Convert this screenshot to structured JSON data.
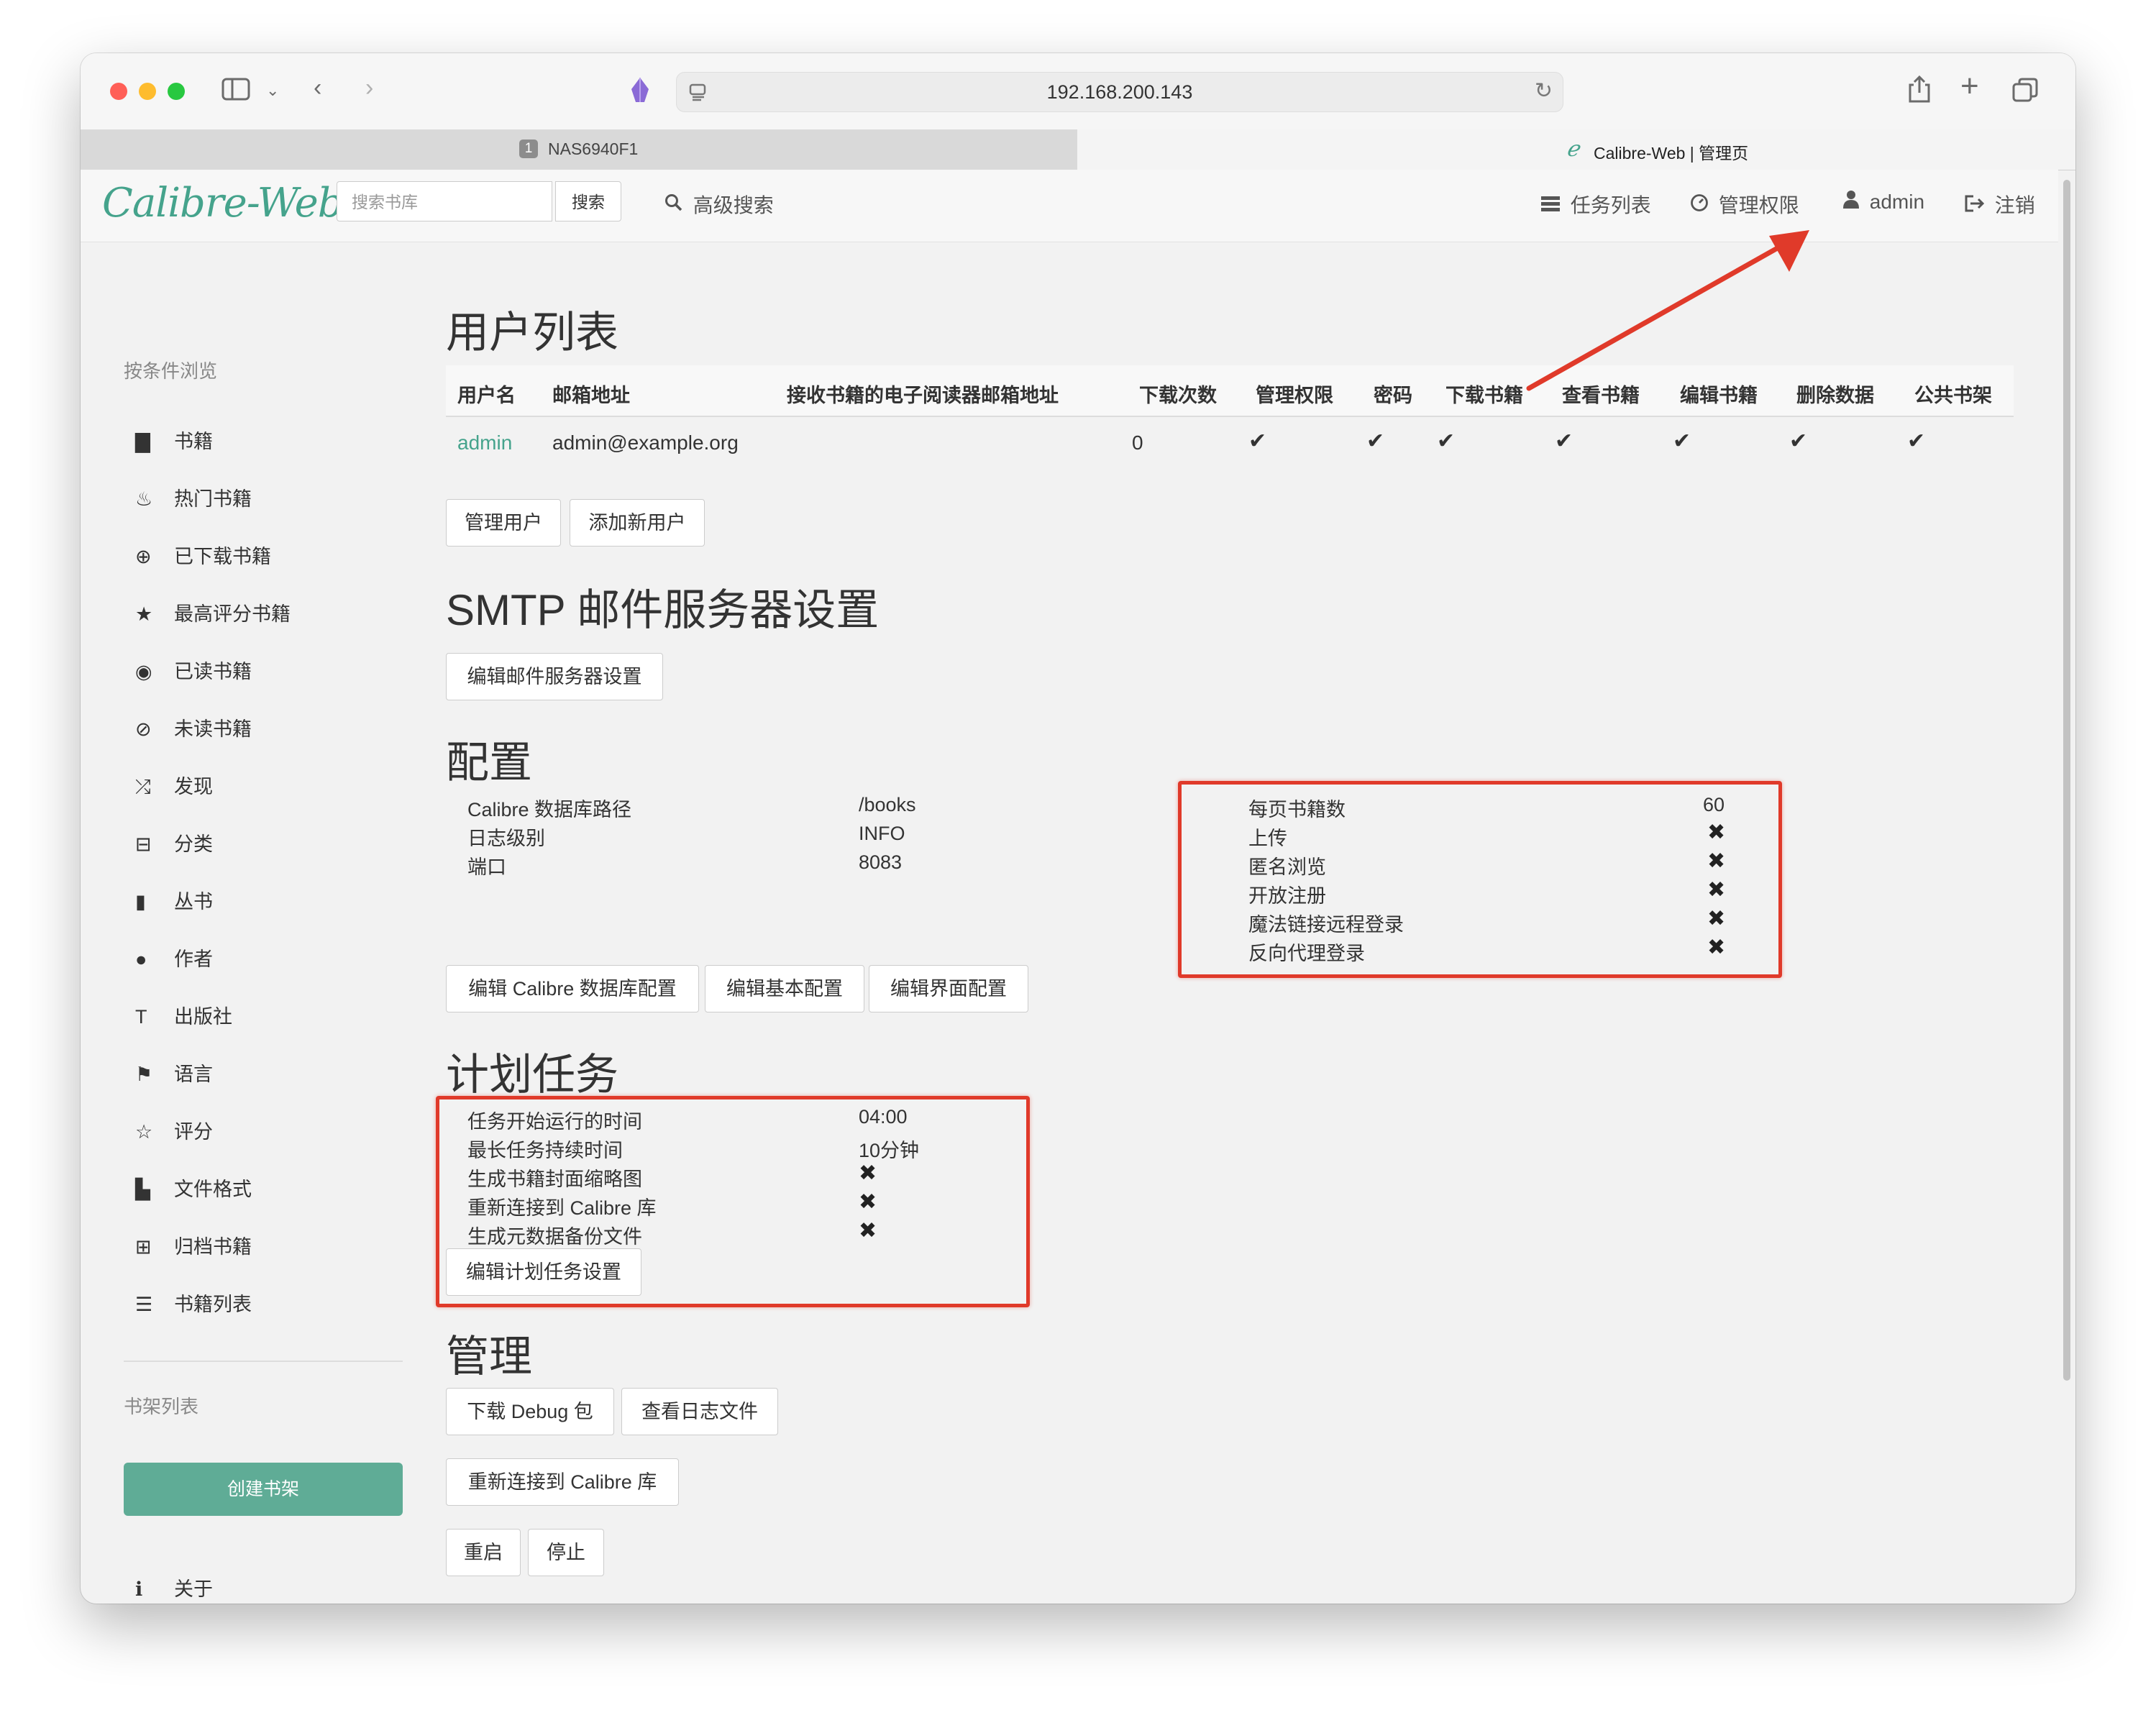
{
  "browser": {
    "url": "192.168.200.143",
    "tabs": [
      {
        "badge": "1",
        "label": "NAS6940F1",
        "close": "×"
      },
      {
        "label": "Calibre-Web | 管理页"
      }
    ]
  },
  "navbar": {
    "logo": "Calibre-Web",
    "search_placeholder": "搜索书库",
    "search_button": "搜索",
    "advanced_search": "高级搜索",
    "tasks": "任务列表",
    "admin_permissions": "管理权限",
    "user": "admin",
    "logout": "注销"
  },
  "sidebar": {
    "browse_header": "按条件浏览",
    "items": [
      {
        "label": "书籍",
        "icon": "book-icon"
      },
      {
        "label": "热门书籍",
        "icon": "fire-icon"
      },
      {
        "label": "已下载书籍",
        "icon": "download-icon"
      },
      {
        "label": "最高评分书籍",
        "icon": "star-icon"
      },
      {
        "label": "已读书籍",
        "icon": "eye-icon"
      },
      {
        "label": "未读书籍",
        "icon": "eye-slash-icon"
      },
      {
        "label": "发现",
        "icon": "random-icon"
      },
      {
        "label": "分类",
        "icon": "inbox-icon"
      },
      {
        "label": "丛书",
        "icon": "bookmark-icon"
      },
      {
        "label": "作者",
        "icon": "user-icon"
      },
      {
        "label": "出版社",
        "icon": "text-size-icon"
      },
      {
        "label": "语言",
        "icon": "flag-icon"
      },
      {
        "label": "评分",
        "icon": "star-empty-icon"
      },
      {
        "label": "文件格式",
        "icon": "file-icon"
      },
      {
        "label": "归档书籍",
        "icon": "trash-icon"
      },
      {
        "label": "书籍列表",
        "icon": "list-icon"
      }
    ],
    "shelves_header": "书架列表",
    "create_shelf": "创建书架",
    "about": "关于"
  },
  "users": {
    "title": "用户列表",
    "columns": [
      "用户名",
      "邮箱地址",
      "接收书籍的电子阅读器邮箱地址",
      "下载次数",
      "管理权限",
      "密码",
      "下载书籍",
      "查看书籍",
      "编辑书籍",
      "删除数据",
      "公共书架"
    ],
    "rows": [
      {
        "username": "admin",
        "email": "admin@example.org",
        "ereader_email": "",
        "downloads": "0",
        "admin": true,
        "password": true,
        "download": true,
        "view": true,
        "edit": true,
        "delete": true,
        "public_shelf": true
      }
    ],
    "manage_users_button": "管理用户",
    "add_user_button": "添加新用户"
  },
  "smtp": {
    "title": "SMTP 邮件服务器设置",
    "edit_button": "编辑邮件服务器设置"
  },
  "config": {
    "title": "配置",
    "left": [
      {
        "label": "Calibre 数据库路径",
        "value": "/books"
      },
      {
        "label": "日志级别",
        "value": "INFO"
      },
      {
        "label": "端口",
        "value": "8083"
      }
    ],
    "right": [
      {
        "label": "每页书籍数",
        "value": "60"
      },
      {
        "label": "上传",
        "value": false
      },
      {
        "label": "匿名浏览",
        "value": false
      },
      {
        "label": "开放注册",
        "value": false
      },
      {
        "label": "魔法链接远程登录",
        "value": false
      },
      {
        "label": "反向代理登录",
        "value": false
      }
    ],
    "buttons": [
      "编辑 Calibre 数据库配置",
      "编辑基本配置",
      "编辑界面配置"
    ]
  },
  "scheduled": {
    "title": "计划任务",
    "items": [
      {
        "label": "任务开始运行的时间",
        "value": "04:00"
      },
      {
        "label": "最长任务持续时间",
        "value": "10分钟"
      },
      {
        "label": "生成书籍封面缩略图",
        "value": false
      },
      {
        "label": "重新连接到 Calibre 库",
        "value": false
      },
      {
        "label": "生成元数据备份文件",
        "value": false
      }
    ],
    "edit_button": "编辑计划任务设置"
  },
  "admin": {
    "title": "管理",
    "download_debug": "下载 Debug 包",
    "view_logs": "查看日志文件",
    "reconnect": "重新连接到 Calibre 库",
    "restart": "重启",
    "stop": "停止"
  },
  "annotation_color": "#e03a2a",
  "accent_color": "#45a38c"
}
